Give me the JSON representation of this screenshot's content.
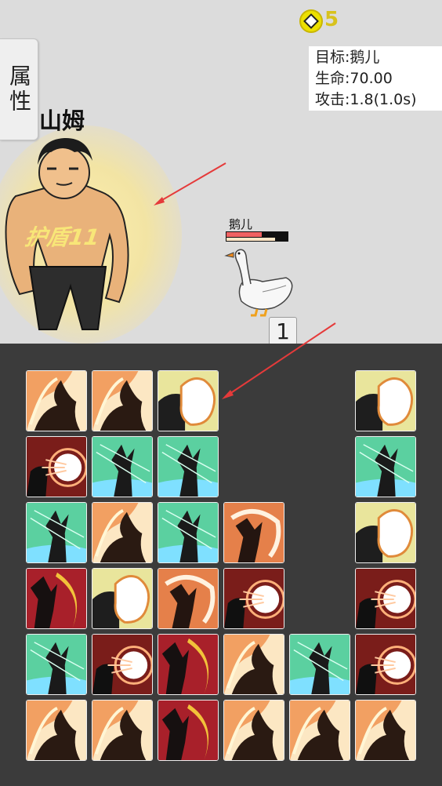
{
  "attr_button": {
    "label": "属性"
  },
  "currency": {
    "count": "5",
    "icon": "coin-icon"
  },
  "target_panel": {
    "target": "目标:鹅儿",
    "hp": "生命:70.00",
    "attack": "攻击:1.8(1.0s)"
  },
  "hero": {
    "name": "山姆",
    "shield_text": "护盾11"
  },
  "enemy": {
    "name": "鹅儿",
    "hp_fraction": 0.58,
    "attack_fraction": 0.8
  },
  "counter": {
    "value": "1"
  },
  "grid": {
    "rows": [
      [
        "fire",
        "fire",
        "blast",
        null,
        null,
        "blast"
      ],
      [
        "burst",
        "wind",
        "wind",
        null,
        null,
        "wind"
      ],
      [
        "wind",
        "fire",
        "wind",
        "slash",
        null,
        "blast"
      ],
      [
        "crescent",
        "blast",
        "slash",
        "burst",
        null,
        "burst"
      ],
      [
        "wind",
        "burst",
        "crescent",
        "fire",
        "wind",
        "burst"
      ],
      [
        "fire",
        "fire",
        "crescent",
        "fire",
        "fire",
        "fire"
      ]
    ]
  },
  "colors": {
    "top_bg": "#dcdcdc",
    "board_bg": "#3b3b3b",
    "coin": "#d8c21d",
    "arrow": "#e53a3a"
  }
}
